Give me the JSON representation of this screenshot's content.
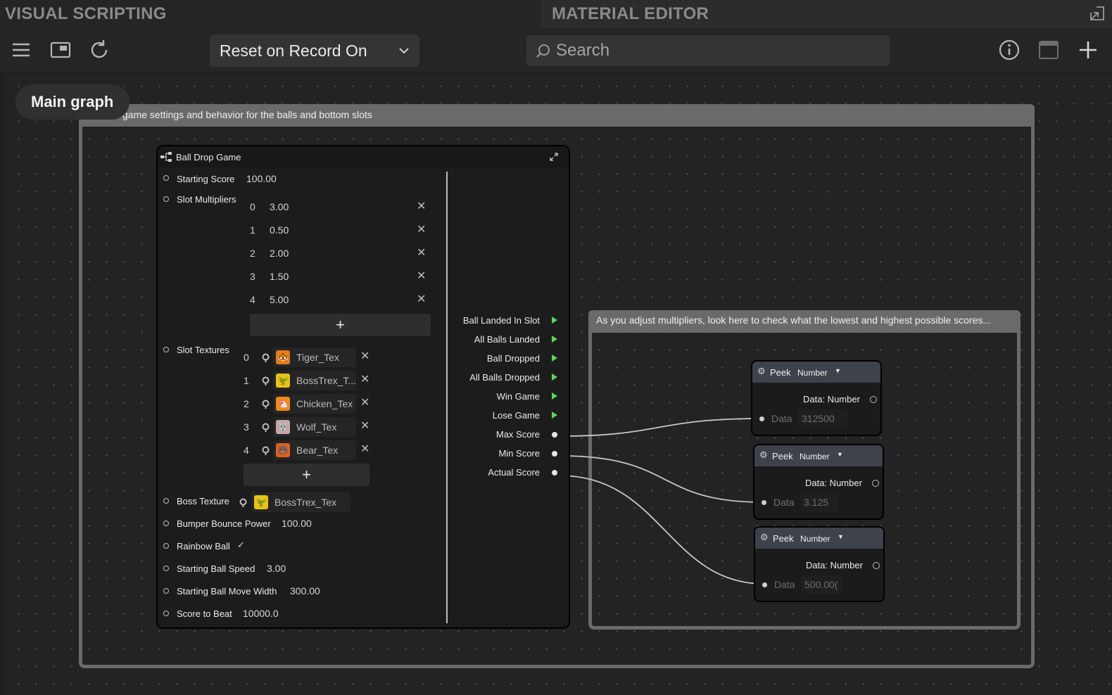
{
  "tabs": {
    "left_title": "VISUAL SCRIPTING",
    "right_title": "MATERIAL EDITOR"
  },
  "toolbar": {
    "dropdown_value": "Reset on Record On",
    "search_placeholder": "Search"
  },
  "canvas": {
    "main_graph_label": "Main graph",
    "outer_group_title": "Control game settings and behavior for the balls and bottom slots",
    "inner_group_title": "As you adjust multipliers, look here to check what the lowest and highest possible scores..."
  },
  "node": {
    "title": "Ball Drop Game",
    "starting_score_label": "Starting Score",
    "starting_score_value": "100.00",
    "slot_multipliers_label": "Slot Multipliers",
    "slot_multipliers": [
      {
        "index": "0",
        "value": "3.00"
      },
      {
        "index": "1",
        "value": "0.50"
      },
      {
        "index": "2",
        "value": "2.00"
      },
      {
        "index": "3",
        "value": "1.50"
      },
      {
        "index": "4",
        "value": "5.00"
      }
    ],
    "add_symbol": "+",
    "remove_symbol": "✕",
    "slot_textures_label": "Slot Textures",
    "slot_textures": [
      {
        "index": "0",
        "name": "Tiger_Tex",
        "icon": "🐯"
      },
      {
        "index": "1",
        "name": "BossTrex_T...",
        "icon": "🦖"
      },
      {
        "index": "2",
        "name": "Chicken_Tex",
        "icon": "🐔"
      },
      {
        "index": "3",
        "name": "Wolf_Tex",
        "icon": "🐺"
      },
      {
        "index": "4",
        "name": "Bear_Tex",
        "icon": "🐻"
      }
    ],
    "boss_texture_label": "Boss Texture",
    "boss_texture_value": "BossTrex_Tex",
    "boss_texture_icon": "🦖",
    "bumper_label": "Bumper Bounce Power",
    "bumper_value": "100.00",
    "rainbow_label": "Rainbow Ball",
    "rainbow_checked": "✓",
    "ball_speed_label": "Starting Ball Speed",
    "ball_speed_value": "3.00",
    "move_width_label": "Starting Ball Move Width",
    "move_width_value": "300.00",
    "score_to_beat_label": "Score to Beat",
    "score_to_beat_value": "10000.0",
    "outputs": {
      "ball_landed_in_slot": "Ball Landed In Slot",
      "all_balls_landed": "All Balls Landed",
      "ball_dropped": "Ball Dropped",
      "all_balls_dropped": "All Balls Dropped",
      "win_game": "Win Game",
      "lose_game": "Lose Game",
      "max_score": "Max Score",
      "min_score": "Min Score",
      "actual_score": "Actual Score"
    }
  },
  "peeks": [
    {
      "title": "Peek",
      "type": "Number",
      "output_label": "Data: Number",
      "input_label": "Data",
      "value": "312500"
    },
    {
      "title": "Peek",
      "type": "Number",
      "output_label": "Data: Number",
      "input_label": "Data",
      "value": "3.125"
    },
    {
      "title": "Peek",
      "type": "Number",
      "output_label": "Data: Number",
      "input_label": "Data",
      "value": "500.00("
    }
  ],
  "colors": {
    "event_port": "#5cd65c",
    "group_border": "#6a6a6a",
    "peek_header": "#3e424a"
  }
}
